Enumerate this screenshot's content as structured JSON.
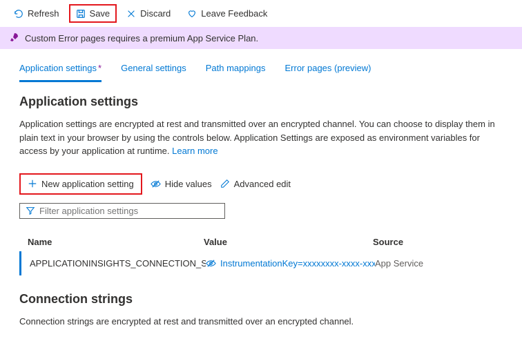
{
  "toolbar": {
    "refresh": "Refresh",
    "save": "Save",
    "discard": "Discard",
    "feedback": "Leave Feedback"
  },
  "banner": {
    "message": "Custom Error pages requires a premium App Service Plan."
  },
  "tabs": {
    "app_settings": "Application settings",
    "general": "General settings",
    "path": "Path mappings",
    "error": "Error pages (preview)"
  },
  "section1": {
    "title": "Application settings",
    "desc": "Application settings are encrypted at rest and transmitted over an encrypted channel. You can choose to display them in plain text in your browser by using the controls below. Application Settings are exposed as environment variables for access by your application at runtime. ",
    "learn_more": "Learn more"
  },
  "actions": {
    "new_setting": "New application setting",
    "hide": "Hide values",
    "advanced": "Advanced edit"
  },
  "filter": {
    "placeholder": "Filter application settings"
  },
  "table": {
    "headers": {
      "name": "Name",
      "value": "Value",
      "source": "Source"
    },
    "rows": [
      {
        "name": "APPLICATIONINSIGHTS_CONNECTION_STRING",
        "value": "InstrumentationKey=xxxxxxxx-xxxx-xxxx",
        "source": "App Service"
      }
    ]
  },
  "section2": {
    "title": "Connection strings",
    "desc": "Connection strings are encrypted at rest and transmitted over an encrypted channel."
  }
}
